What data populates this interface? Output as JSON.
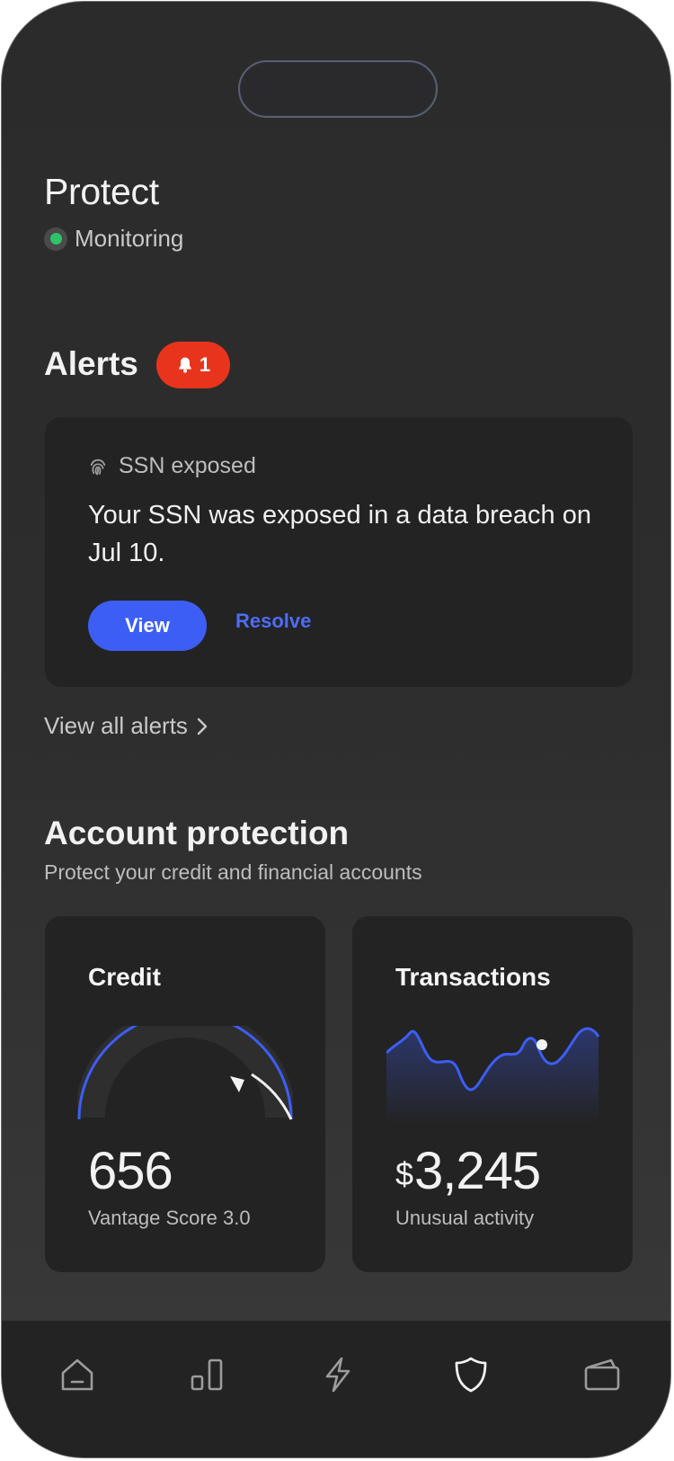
{
  "header": {
    "title": "Protect",
    "status": "Monitoring"
  },
  "alerts": {
    "title": "Alerts",
    "badge_count": "1",
    "card": {
      "type": "SSN exposed",
      "message": "Your SSN was exposed in a data breach on Jul 10.",
      "primary_action": "View",
      "secondary_action": "Resolve"
    },
    "view_all": "View all alerts"
  },
  "account_protection": {
    "title": "Account protection",
    "subtitle": "Protect your credit and financial accounts",
    "credit": {
      "title": "Credit",
      "score": "656",
      "score_label": "Vantage Score 3.0",
      "gauge_fraction": 0.87
    },
    "transactions": {
      "title": "Transactions",
      "currency": "$",
      "amount": "3,245",
      "label": "Unusual activity"
    }
  },
  "tabbar": {
    "items": [
      "home-icon",
      "chart-icon",
      "lightning-icon",
      "shield-icon",
      "wallet-icon"
    ],
    "active": "shield-icon"
  },
  "colors": {
    "accent": "#3d5ef5",
    "alert": "#e8341c",
    "monitoring": "#2ec36a"
  }
}
